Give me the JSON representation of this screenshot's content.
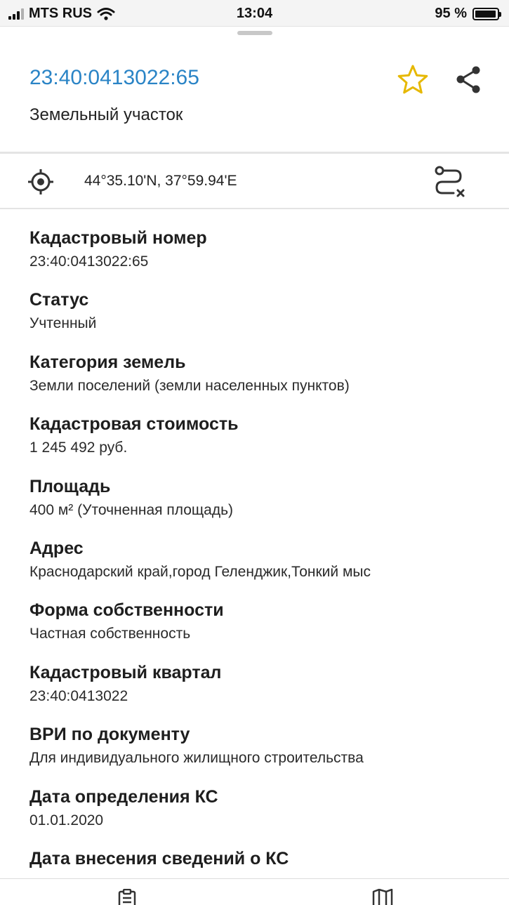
{
  "status_bar": {
    "carrier": "MTS RUS",
    "time": "13:04",
    "battery_percent": "95 %",
    "battery_level": 0.95,
    "signal_bars": 4,
    "signal_bars_active": 3,
    "icons": [
      "signal-icon",
      "wifi-icon",
      "battery-icon"
    ]
  },
  "header": {
    "cadastral_link": "23:40:0413022:65",
    "object_type": "Земельный участок",
    "link_color": "#2a84c6",
    "star_color": "#e6b800",
    "icons": [
      "star-icon",
      "share-icon"
    ]
  },
  "location": {
    "coordinates": "44°35.10'N, 37°59.94'E",
    "icons": [
      "target-icon",
      "route-icon"
    ]
  },
  "fields": [
    {
      "label": "Кадастровый номер",
      "value": "23:40:0413022:65"
    },
    {
      "label": "Статус",
      "value": "Учтенный"
    },
    {
      "label": "Категория земель",
      "value": "Земли поселений (земли населенных пунктов)"
    },
    {
      "label": "Кадастровая стоимость",
      "value": "1 245 492 руб."
    },
    {
      "label": "Площадь",
      "value": "400 м² (Уточненная площадь)"
    },
    {
      "label": "Адрес",
      "value": "Краснодарский край,город Геленджик,Тонкий мыс"
    },
    {
      "label": "Форма собственности",
      "value": "Частная собственность"
    },
    {
      "label": "Кадастровый квартал",
      "value": "23:40:0413022"
    },
    {
      "label": "ВРИ по документу",
      "value": "Для индивидуального жилищного строительства"
    },
    {
      "label": "Дата определения КС",
      "value": "01.01.2020"
    },
    {
      "label": "Дата внесения сведений о КС"
    }
  ],
  "tab_bar": {
    "icons": [
      "clipboard-icon",
      "map-icon"
    ]
  }
}
